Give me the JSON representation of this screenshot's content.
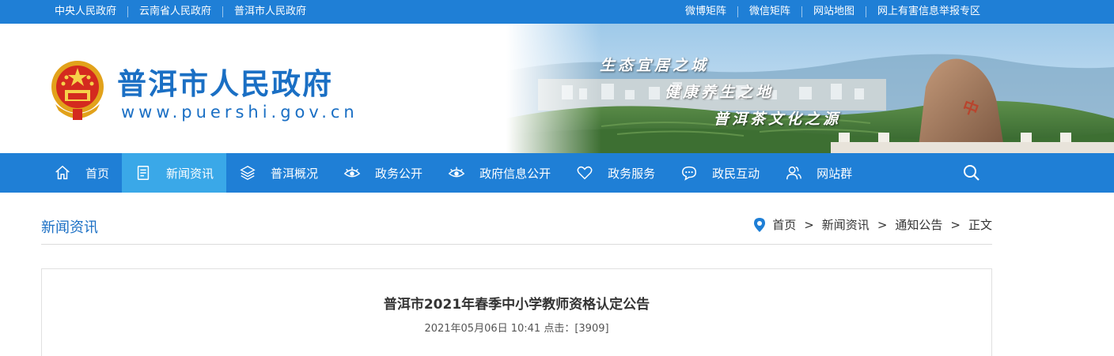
{
  "topbar": {
    "left_links": [
      "中央人民政府",
      "云南省人民政府",
      "普洱市人民政府"
    ],
    "right_links": [
      "微博矩阵",
      "微信矩阵",
      "网站地图",
      "网上有害信息举报专区"
    ]
  },
  "header": {
    "title": "普洱市人民政府",
    "url": "www.puershi.gov.cn",
    "slogans": [
      "生态宜居之城",
      "健康养生之地",
      "普洱茶文化之源"
    ]
  },
  "nav": {
    "items": [
      {
        "label": "首页",
        "icon": "home-icon"
      },
      {
        "label": "新闻资讯",
        "icon": "news-icon",
        "active": true
      },
      {
        "label": "普洱概况",
        "icon": "layers-icon"
      },
      {
        "label": "政务公开",
        "icon": "eye-icon"
      },
      {
        "label": "政府信息公开",
        "icon": "eye-icon"
      },
      {
        "label": "政务服务",
        "icon": "heart-icon"
      },
      {
        "label": "政民互动",
        "icon": "chat-icon"
      },
      {
        "label": "网站群",
        "icon": "users-icon"
      }
    ]
  },
  "section": {
    "title": "新闻资讯",
    "breadcrumb": [
      "首页",
      "新闻资讯",
      "通知公告",
      "正文"
    ],
    "separator": ">"
  },
  "article": {
    "title": "普洱市2021年春季中小学教师资格认定公告",
    "meta": "2021年05月06日 10:41  点击：[3909]"
  },
  "colors": {
    "primary": "#1f7fd6",
    "active_tab": "#3aa8e8",
    "title_blue": "#1a6fc4"
  }
}
